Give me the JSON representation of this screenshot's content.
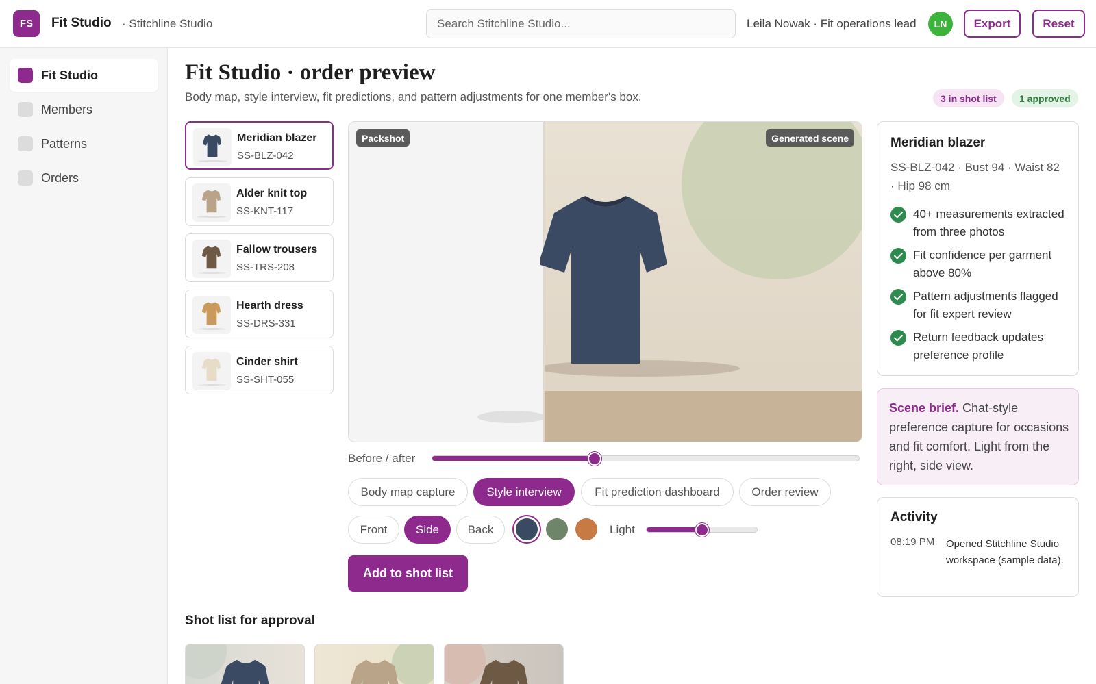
{
  "header": {
    "logo_text": "FS",
    "app_title": "Fit Studio",
    "workspace": "· Stitchline Studio",
    "search_placeholder": "Search Stitchline Studio...",
    "user": "Leila Nowak · Fit operations lead",
    "avatar_initials": "LN",
    "export_label": "Export",
    "reset_label": "Reset"
  },
  "sidebar": {
    "items": [
      {
        "label": "Fit Studio",
        "active": true
      },
      {
        "label": "Members",
        "active": false
      },
      {
        "label": "Patterns",
        "active": false
      },
      {
        "label": "Orders",
        "active": false
      }
    ]
  },
  "main": {
    "title": "Fit Studio · order preview",
    "subtitle": "Body map, style interview, fit predictions, and pattern adjustments for one member's box.",
    "badges": {
      "shot_list": "3 in shot list",
      "approved": "1 approved"
    }
  },
  "products": [
    {
      "name": "Meridian blazer",
      "sku": "SS-BLZ-042",
      "color": "#3b4a63",
      "active": true
    },
    {
      "name": "Alder knit top",
      "sku": "SS-KNT-117",
      "color": "#b9a489",
      "active": false
    },
    {
      "name": "Fallow trousers",
      "sku": "SS-TRS-208",
      "color": "#6e5944",
      "active": false
    },
    {
      "name": "Hearth dress",
      "sku": "SS-DRS-331",
      "color": "#c99a5b",
      "active": false
    },
    {
      "name": "Cinder shirt",
      "sku": "SS-SHT-055",
      "color": "#e6dcc8",
      "active": false
    }
  ],
  "preview": {
    "packshot_tag": "Packshot",
    "generated_tag": "Generated scene",
    "before_after_label": "Before / after",
    "before_after_value": 0.38
  },
  "modes": [
    {
      "label": "Body map capture",
      "on": false
    },
    {
      "label": "Style interview",
      "on": true
    },
    {
      "label": "Fit prediction dashboard",
      "on": false
    },
    {
      "label": "Order review",
      "on": false
    }
  ],
  "views": [
    {
      "label": "Front",
      "on": false
    },
    {
      "label": "Side",
      "on": true
    },
    {
      "label": "Back",
      "on": false
    }
  ],
  "swatches": [
    {
      "color": "#3b4a63",
      "selected": true
    },
    {
      "color": "#6e8569",
      "selected": false
    },
    {
      "color": "#c87a45",
      "selected": false
    }
  ],
  "light": {
    "label": "Light",
    "value": 0.5
  },
  "primary_action": "Add to shot list",
  "shot_list_title": "Shot list for approval",
  "detail": {
    "title": "Meridian blazer",
    "meta": "SS-BLZ-042 · Bust 94 · Waist 82 · Hip 98 cm",
    "checks": [
      "40+ measurements extracted from three photos",
      "Fit confidence per garment above 80%",
      "Pattern adjustments flagged for fit expert review",
      "Return feedback updates preference profile"
    ]
  },
  "brief": {
    "label": "Scene brief.",
    "text": " Chat-style preference capture for occasions and fit comfort. Light from the right, side view."
  },
  "activity": {
    "title": "Activity",
    "time": "08:19 PM",
    "text": "Opened Stitchline Studio workspace (sample data)."
  },
  "colors": {
    "accent": "#8e2a8e",
    "success": "#2e8b4e"
  }
}
